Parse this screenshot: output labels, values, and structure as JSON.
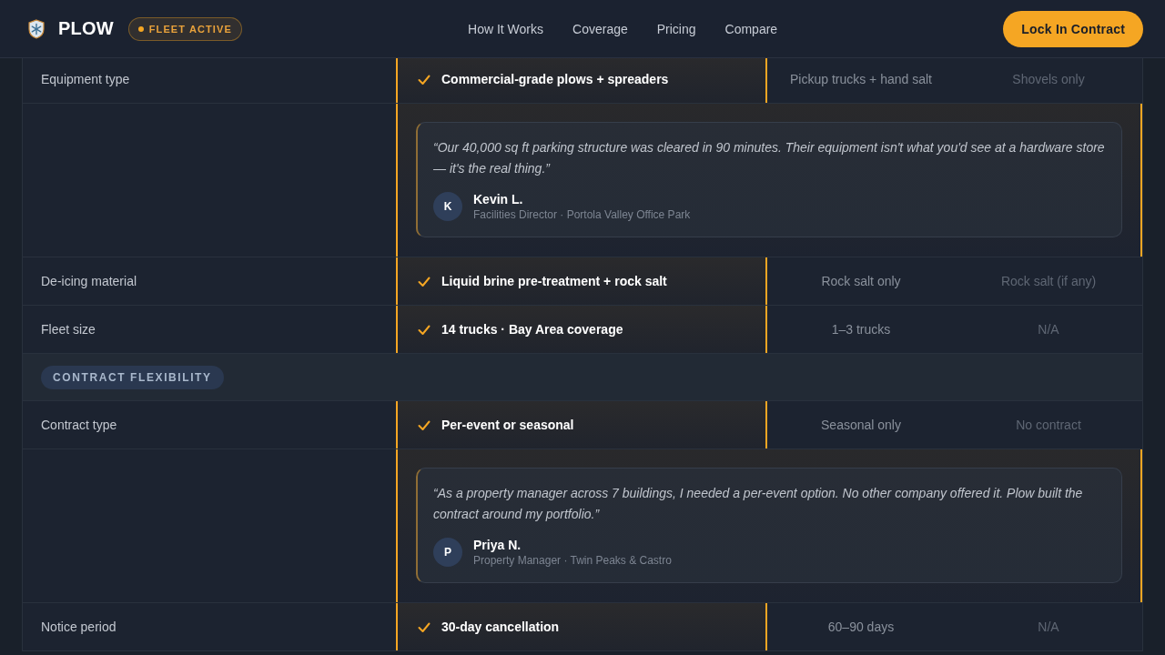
{
  "header": {
    "brand": "PLOW",
    "status_badge": "FLEET ACTIVE",
    "nav": [
      "How It Works",
      "Coverage",
      "Pricing",
      "Compare"
    ],
    "cta_button": "Lock In Contract"
  },
  "comparison": {
    "rows": [
      {
        "kind": "feature",
        "cells": [
          "Equipment type",
          "Commercial-grade plows + spreaders",
          "Pickup trucks + hand salt",
          "Shovels only"
        ]
      },
      {
        "kind": "testimonial",
        "quote": "“Our 40,000 sq ft parking structure was cleared in 90 minutes. Their equipment isn't what you'd see at a hardware store — it's the real thing.”",
        "author": {
          "initial": "K",
          "name": "Kevin L.",
          "role": "Facilities Director · Portola Valley Office Park"
        }
      },
      {
        "kind": "feature",
        "cells": [
          "De-icing material",
          "Liquid brine pre-treatment + rock salt",
          "Rock salt only",
          "Rock salt (if any)"
        ]
      },
      {
        "kind": "feature",
        "cells": [
          "Fleet size",
          "14 trucks · Bay Area coverage",
          "1–3 trucks",
          "N/A"
        ]
      },
      {
        "kind": "section",
        "label": "CONTRACT FLEXIBILITY"
      },
      {
        "kind": "feature",
        "cells": [
          "Contract type",
          "Per-event or seasonal",
          "Seasonal only",
          "No contract"
        ]
      },
      {
        "kind": "testimonial",
        "quote": "“As a property manager across 7 buildings, I needed a per-event option. No other company offered it. Plow built the contract around my portfolio.”",
        "author": {
          "initial": "P",
          "name": "Priya N.",
          "role": "Property Manager · Twin Peaks & Castro"
        }
      },
      {
        "kind": "feature",
        "cells": [
          "Notice period",
          "30-day cancellation",
          "60–90 days",
          "N/A"
        ]
      }
    ]
  }
}
